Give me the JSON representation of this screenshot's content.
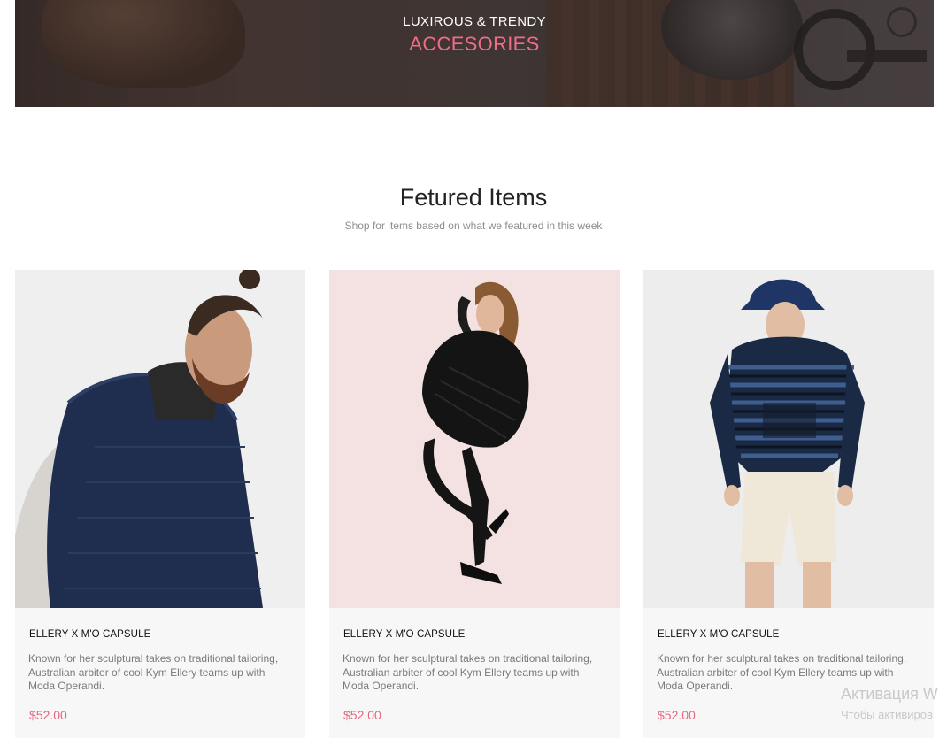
{
  "hero": {
    "subtitle": "LUXIROUS & TRENDY",
    "title": "ACCESORIES"
  },
  "featured": {
    "title": "Fetured Items",
    "subtitle": "Shop for items based on what we featured in this week"
  },
  "products": [
    {
      "name": "ELLERY X M'O CAPSULE",
      "description": "Known for her sculptural takes on traditional tailoring, Australian arbiter of cool Kym Ellery teams up with Moda Operandi.",
      "price": "$52.00",
      "image_bg": "#eeeeee"
    },
    {
      "name": "ELLERY X M'O CAPSULE",
      "description": "Known for her sculptural takes on traditional tailoring, Australian arbiter of cool Kym Ellery teams up with Moda Operandi.",
      "price": "$52.00",
      "image_bg": "#f4e1e1"
    },
    {
      "name": "ELLERY X M'O CAPSULE",
      "description": "Known for her sculptural takes on traditional tailoring, Australian arbiter of cool Kym Ellery teams up with Moda Operandi.",
      "price": "$52.00",
      "image_bg": "#ededed"
    }
  ],
  "watermark": {
    "line1": "Активация W",
    "line2": "Чтобы активиров"
  },
  "colors": {
    "accent": "#f06d86",
    "price": "#e8667f",
    "card_bg": "#f7f7f7"
  }
}
